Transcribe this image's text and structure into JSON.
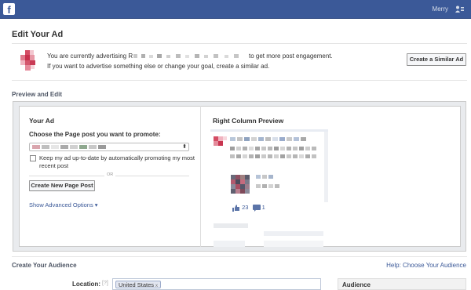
{
  "header": {
    "logo": "f",
    "user_name": "Merry",
    "user_icon": "friend-requests-icon"
  },
  "page": {
    "title": "Edit Your Ad"
  },
  "info": {
    "line1_prefix": "You are currently advertising R",
    "line1_suffix": "to get more post engagement.",
    "line2": "If you want to advertise something else or change your goal, create a similar ad.",
    "similar_button": "Create a Similar Ad"
  },
  "preview_edit": {
    "heading": "Preview and Edit",
    "your_ad": {
      "heading": "Your Ad",
      "choose_label": "Choose the Page post you want to promote:",
      "checkbox_label": "Keep my ad up-to-date by automatically promoting my most recent post",
      "checkbox_checked": false,
      "or_text": "OR",
      "create_post_button": "Create New Page Post",
      "advanced_link": "Show Advanced Options ▾"
    },
    "right_column": {
      "heading": "Right Column Preview",
      "likes": "23",
      "comments": "1"
    }
  },
  "audience": {
    "heading": "Create Your Audience",
    "help_link": "Help: Choose Your Audience",
    "location_label": "Location:",
    "location_hint": "[?]",
    "location_token": "United States",
    "token_remove": "x",
    "side_label": "Audience"
  },
  "colors": {
    "brand": "#3b5998",
    "panel_bg": "#e9ebee"
  }
}
